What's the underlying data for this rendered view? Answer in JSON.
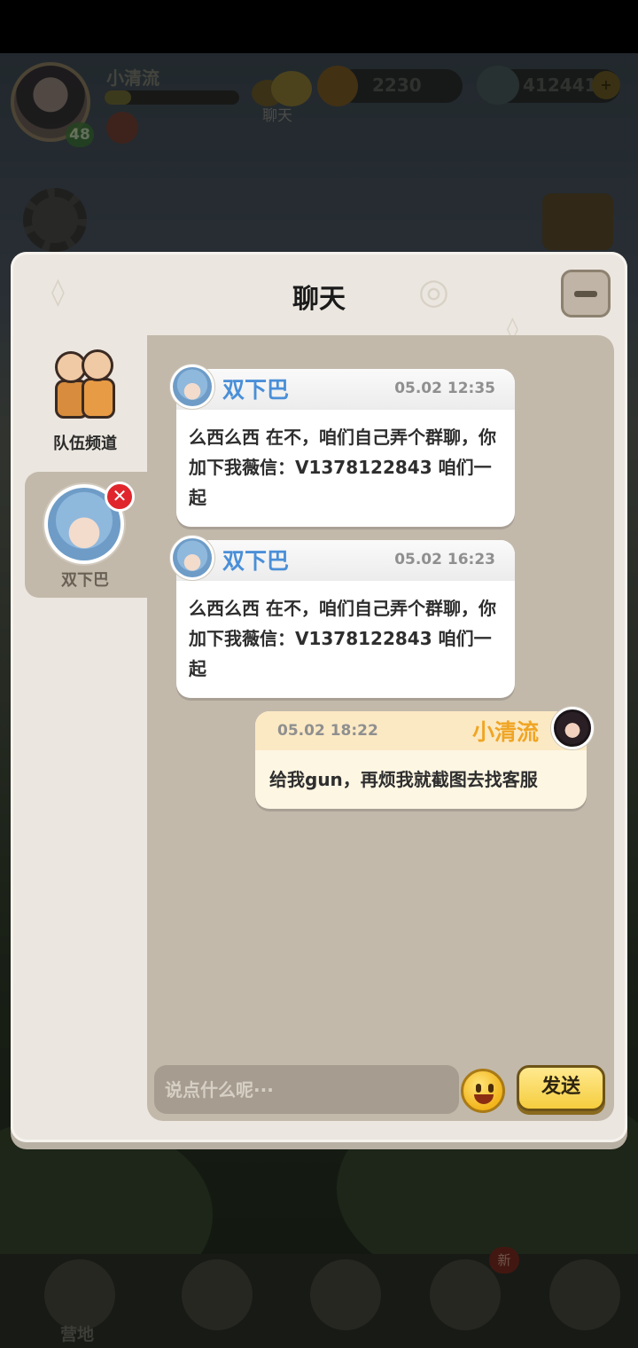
{
  "hud": {
    "player_name": "小清流",
    "player_level": "48",
    "chat_label": "聊天",
    "coins": "2230",
    "gems": "412441",
    "plus": "+",
    "xp_progress": 0.2
  },
  "panel": {
    "title": "聊天"
  },
  "channels": {
    "team_label": "队伍频道",
    "dm_label": "双下巴",
    "dm_close": "✕"
  },
  "messages": [
    {
      "direction": "in",
      "name": "双下巴",
      "time": "05.02 12:35",
      "text": "么西么西 在不，咱们自己弄个群聊，你加下我薇信：V1378122843 咱们一起"
    },
    {
      "direction": "in",
      "name": "双下巴",
      "time": "05.02 16:23",
      "text": "么西么西 在不，咱们自己弄个群聊，你加下我薇信：V1378122843 咱们一起"
    },
    {
      "direction": "out",
      "name": "小清流",
      "time": "05.02 18:22",
      "text": "给我gun，再烦我就截图去找客服"
    }
  ],
  "input": {
    "placeholder": "说点什么呢···",
    "send_label": "发送"
  },
  "bottom_nav": {
    "camp_label": "营地",
    "new_badge": "新"
  },
  "colors": {
    "incoming_name": "#4a8fd8",
    "outgoing_name": "#f0a524",
    "panel_bg": "#ebe6df",
    "message_area_bg": "#c2b9ab"
  }
}
